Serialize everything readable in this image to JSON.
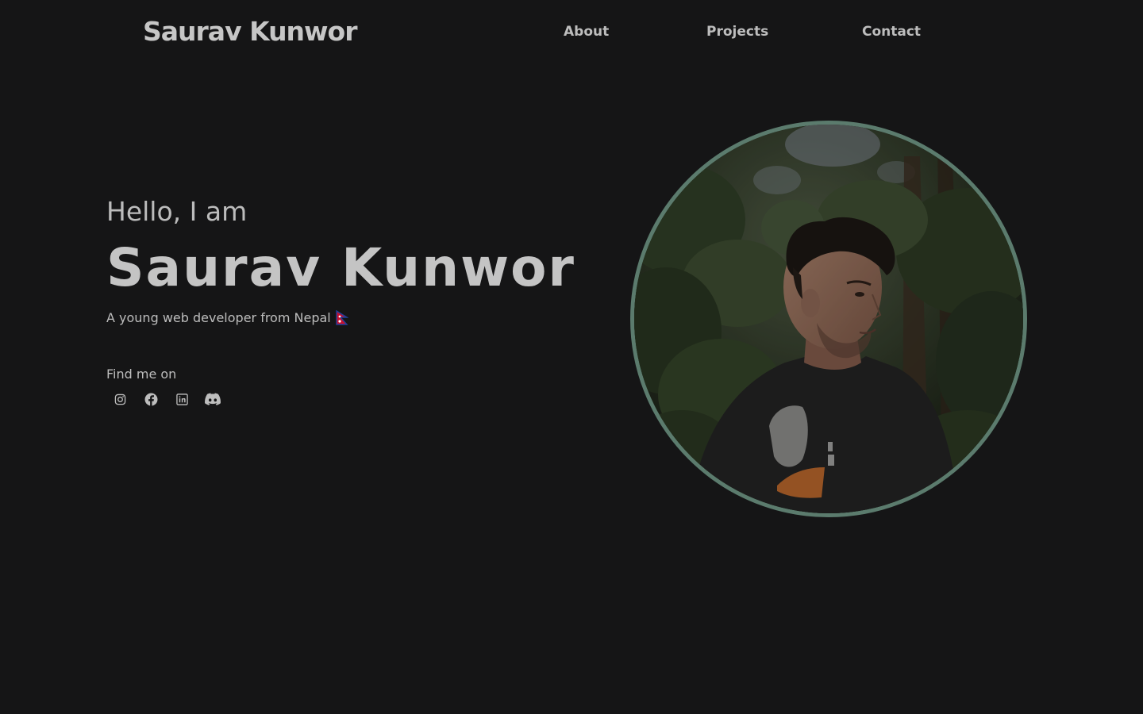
{
  "header": {
    "brand": "Saurav Kunwor",
    "nav": [
      {
        "label": "About"
      },
      {
        "label": "Projects"
      },
      {
        "label": "Contact"
      }
    ]
  },
  "hero": {
    "greeting": "Hello, I am",
    "name": "Saurav Kunwor",
    "tagline": "A young web developer from Nepal",
    "flag_icon": "nepal-flag-icon",
    "portrait_icon": "profile-photo",
    "portrait_border_color": "#5b7b6d"
  },
  "social": {
    "label": "Find me on",
    "links": [
      {
        "icon": "instagram-icon"
      },
      {
        "icon": "facebook-icon"
      },
      {
        "icon": "linkedin-icon"
      },
      {
        "icon": "discord-icon"
      }
    ]
  },
  "colors": {
    "background": "#151516",
    "text": "#c9c9c9"
  }
}
